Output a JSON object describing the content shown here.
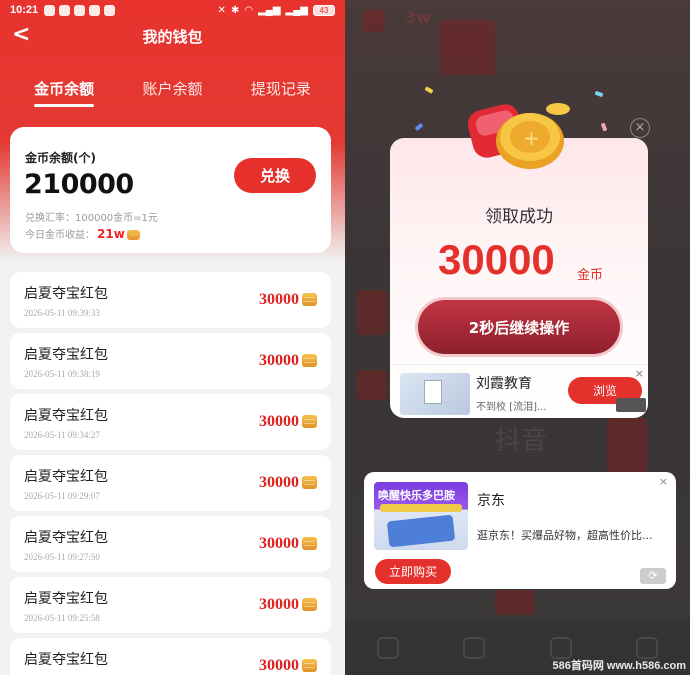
{
  "left": {
    "statusbar": {
      "time": "10:21",
      "battery": "43"
    },
    "nav": {
      "back_glyph": "<",
      "title": "我的钱包"
    },
    "tabs": [
      {
        "label": "金币余额",
        "active": true
      },
      {
        "label": "账户余额",
        "active": false
      },
      {
        "label": "提现记录",
        "active": false
      }
    ],
    "balance": {
      "label": "金币余额(个)",
      "value": "210000",
      "exchange_label": "兑换",
      "rate": "兑换汇率：100000金币=1元",
      "today_label": "今日金币收益：",
      "today_amount": "21w"
    },
    "records": [
      {
        "title": "启夏夺宝红包",
        "time": "2026-05-11 09:39:33",
        "amount": "30000"
      },
      {
        "title": "启夏夺宝红包",
        "time": "2026-05-11 09:38:19",
        "amount": "30000"
      },
      {
        "title": "启夏夺宝红包",
        "time": "2026-05-11 09:34:27",
        "amount": "30000"
      },
      {
        "title": "启夏夺宝红包",
        "time": "2026-05-11 09:29:07",
        "amount": "30000"
      },
      {
        "title": "启夏夺宝红包",
        "time": "2026-05-11 09:27:50",
        "amount": "30000"
      },
      {
        "title": "启夏夺宝红包",
        "time": "2026-05-11 09:25:58",
        "amount": "30000"
      },
      {
        "title": "启夏夺宝红包",
        "time": "",
        "amount": "30000"
      }
    ]
  },
  "right": {
    "background": {
      "big_text": "抖音"
    },
    "modal": {
      "title": "领取成功",
      "amount": "30000",
      "unit": "金币",
      "continue_label": "2秒后继续操作",
      "ad": {
        "name": "刘霞教育",
        "desc": "不到校 [流泪]...",
        "browse_label": "浏览"
      }
    },
    "jd_ad": {
      "thumb_text": "唤醒快乐多巴胺",
      "brand": "京东",
      "desc": "逛京东！买爆品好物，超高性价比...",
      "buy_label": "立即购买"
    },
    "watermark": "586首码网 www.h586.com"
  },
  "colors": {
    "brand_red": "#e5302b",
    "amount_red": "#e0201f",
    "coin_gold": "#f5c24a"
  }
}
